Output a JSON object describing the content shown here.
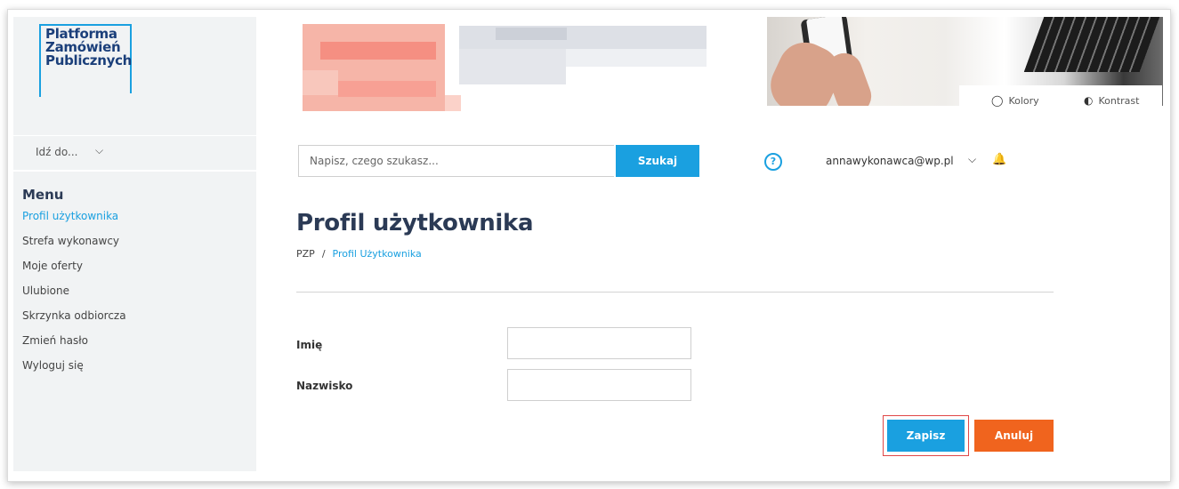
{
  "logo": {
    "line1": "Platforma",
    "line2": "Zamówień",
    "line3": "Publicznych"
  },
  "goto": {
    "label": "Idź do...",
    "chevron": "⌵"
  },
  "menu": {
    "title": "Menu",
    "items": [
      {
        "label": "Profil użytkownika"
      },
      {
        "label": "Strefa wykonawcy"
      },
      {
        "label": "Moje oferty"
      },
      {
        "label": "Ulubione"
      },
      {
        "label": "Skrzynka odbiorcza"
      },
      {
        "label": "Zmień hasło"
      },
      {
        "label": "Wyloguj się"
      }
    ]
  },
  "accessibility": {
    "colors_label": "Kolory",
    "contrast_label": "Kontrast"
  },
  "search": {
    "placeholder": "Napisz, czego szukasz...",
    "button": "Szukaj"
  },
  "help": {
    "glyph": "?"
  },
  "user": {
    "email": "annawykonawca@wp.pl",
    "chevron": "⌵"
  },
  "page": {
    "title": "Profil użytkownika"
  },
  "breadcrumb": {
    "root": "PZP",
    "separator": "/",
    "current": "Profil Użytkownika"
  },
  "form": {
    "first_name_label": "Imię",
    "first_name_value": "",
    "last_name_label": "Nazwisko",
    "last_name_value": "",
    "save": "Zapisz",
    "cancel": "Anuluj"
  },
  "colors": {
    "accent": "#1aa0e0",
    "cancel": "#f0641e",
    "heading": "#2b3a55",
    "highlight_border": "#e04747"
  }
}
